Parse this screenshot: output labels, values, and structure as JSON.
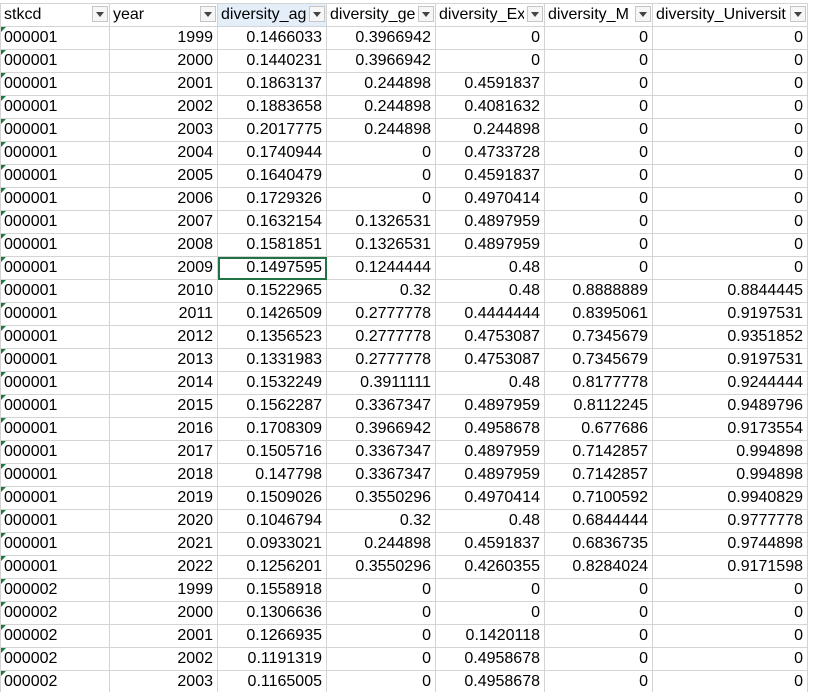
{
  "columns": [
    "stkcd",
    "year",
    "diversity_ag",
    "diversity_ge",
    "diversity_Ex",
    "diversity_M",
    "diversity_Universit"
  ],
  "sorted_column_index": 2,
  "selected_cell": {
    "row": 10,
    "col": 2
  },
  "colors": {
    "grid_line": "#d4d4d4",
    "selection_border": "#217346",
    "error_triangle": "#1e7a3c",
    "sorted_header_bg": "#e3eef9"
  },
  "rows": [
    [
      "000001",
      "1999",
      "0.1466033",
      "0.3966942",
      "0",
      "0",
      "0"
    ],
    [
      "000001",
      "2000",
      "0.1440231",
      "0.3966942",
      "0",
      "0",
      "0"
    ],
    [
      "000001",
      "2001",
      "0.1863137",
      "0.244898",
      "0.4591837",
      "0",
      "0"
    ],
    [
      "000001",
      "2002",
      "0.1883658",
      "0.244898",
      "0.4081632",
      "0",
      "0"
    ],
    [
      "000001",
      "2003",
      "0.2017775",
      "0.244898",
      "0.244898",
      "0",
      "0"
    ],
    [
      "000001",
      "2004",
      "0.1740944",
      "0",
      "0.4733728",
      "0",
      "0"
    ],
    [
      "000001",
      "2005",
      "0.1640479",
      "0",
      "0.4591837",
      "0",
      "0"
    ],
    [
      "000001",
      "2006",
      "0.1729326",
      "0",
      "0.4970414",
      "0",
      "0"
    ],
    [
      "000001",
      "2007",
      "0.1632154",
      "0.1326531",
      "0.4897959",
      "0",
      "0"
    ],
    [
      "000001",
      "2008",
      "0.1581851",
      "0.1326531",
      "0.4897959",
      "0",
      "0"
    ],
    [
      "000001",
      "2009",
      "0.1497595",
      "0.1244444",
      "0.48",
      "0",
      "0"
    ],
    [
      "000001",
      "2010",
      "0.1522965",
      "0.32",
      "0.48",
      "0.8888889",
      "0.8844445"
    ],
    [
      "000001",
      "2011",
      "0.1426509",
      "0.2777778",
      "0.4444444",
      "0.8395061",
      "0.9197531"
    ],
    [
      "000001",
      "2012",
      "0.1356523",
      "0.2777778",
      "0.4753087",
      "0.7345679",
      "0.9351852"
    ],
    [
      "000001",
      "2013",
      "0.1331983",
      "0.2777778",
      "0.4753087",
      "0.7345679",
      "0.9197531"
    ],
    [
      "000001",
      "2014",
      "0.1532249",
      "0.3911111",
      "0.48",
      "0.8177778",
      "0.9244444"
    ],
    [
      "000001",
      "2015",
      "0.1562287",
      "0.3367347",
      "0.4897959",
      "0.8112245",
      "0.9489796"
    ],
    [
      "000001",
      "2016",
      "0.1708309",
      "0.3966942",
      "0.4958678",
      "0.677686",
      "0.9173554"
    ],
    [
      "000001",
      "2017",
      "0.1505716",
      "0.3367347",
      "0.4897959",
      "0.7142857",
      "0.994898"
    ],
    [
      "000001",
      "2018",
      "0.147798",
      "0.3367347",
      "0.4897959",
      "0.7142857",
      "0.994898"
    ],
    [
      "000001",
      "2019",
      "0.1509026",
      "0.3550296",
      "0.4970414",
      "0.7100592",
      "0.9940829"
    ],
    [
      "000001",
      "2020",
      "0.1046794",
      "0.32",
      "0.48",
      "0.6844444",
      "0.9777778"
    ],
    [
      "000001",
      "2021",
      "0.0933021",
      "0.244898",
      "0.4591837",
      "0.6836735",
      "0.9744898"
    ],
    [
      "000001",
      "2022",
      "0.1256201",
      "0.3550296",
      "0.4260355",
      "0.8284024",
      "0.9171598"
    ],
    [
      "000002",
      "1999",
      "0.1558918",
      "0",
      "0",
      "0",
      "0"
    ],
    [
      "000002",
      "2000",
      "0.1306636",
      "0",
      "0",
      "0",
      "0"
    ],
    [
      "000002",
      "2001",
      "0.1266935",
      "0",
      "0.1420118",
      "0",
      "0"
    ],
    [
      "000002",
      "2002",
      "0.1191319",
      "0",
      "0.4958678",
      "0",
      "0"
    ],
    [
      "000002",
      "2003",
      "0.1165005",
      "0",
      "0.4958678",
      "0",
      "0"
    ]
  ]
}
